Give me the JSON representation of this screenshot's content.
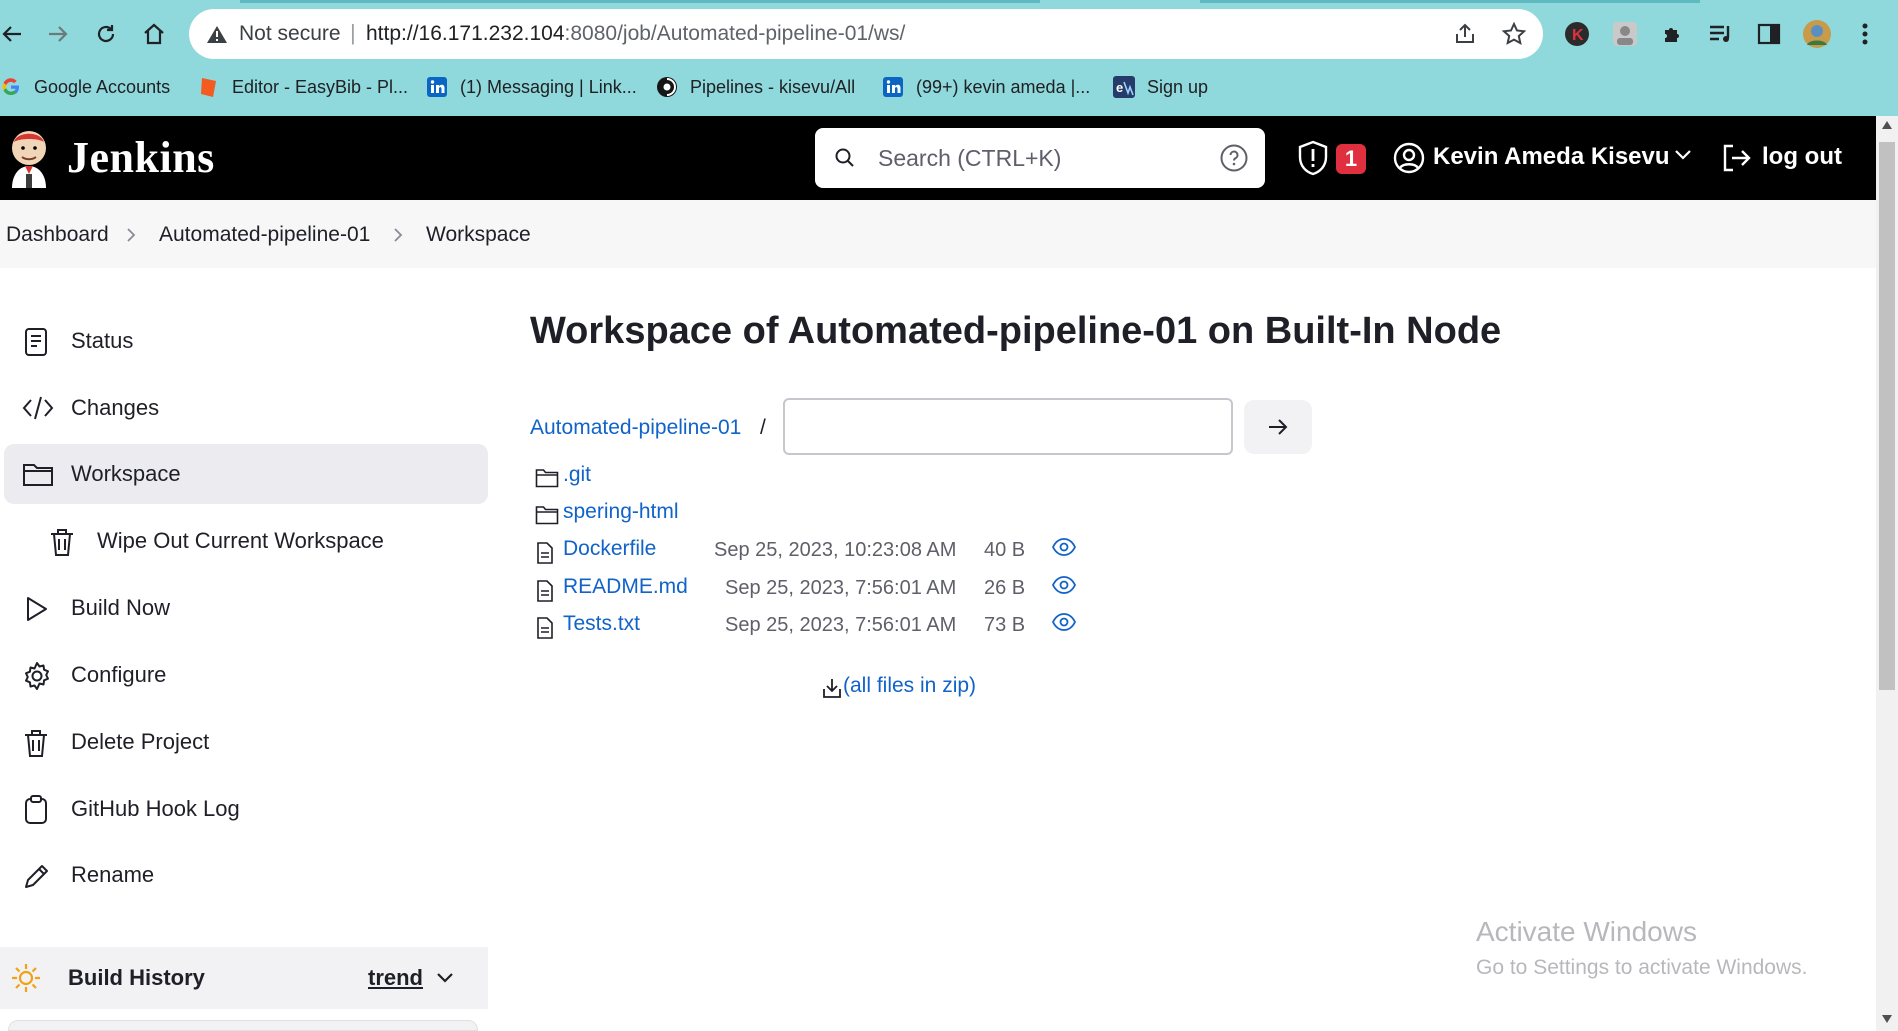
{
  "browser": {
    "security_label": "Not secure",
    "url_host": "http://16.171.232.104",
    "url_rest": ":8080/job/Automated-pipeline-01/ws/",
    "bookmarks": [
      {
        "label": "Google Accounts",
        "icon": "google-icon"
      },
      {
        "label": "Editor - EasyBib - Pl...",
        "icon": "easybib-icon"
      },
      {
        "label": "(1) Messaging | Link...",
        "icon": "linkedin-icon"
      },
      {
        "label": "Pipelines - kisevu/All",
        "icon": "circleci-icon"
      },
      {
        "label": "(99+) kevin ameda |...",
        "icon": "linkedin-icon"
      },
      {
        "label": "Sign up",
        "icon": "signup-icon"
      }
    ]
  },
  "header": {
    "brand": "Jenkins",
    "search_placeholder": "Search (CTRL+K)",
    "security_count": "1",
    "user_name": "Kevin Ameda Kisevu",
    "logout_label": "log out"
  },
  "breadcrumb": [
    "Dashboard",
    "Automated-pipeline-01",
    "Workspace"
  ],
  "sidebar": {
    "items": [
      {
        "label": "Status",
        "icon": "status-icon"
      },
      {
        "label": "Changes",
        "icon": "code-icon"
      },
      {
        "label": "Workspace",
        "icon": "folder-icon",
        "active": true
      },
      {
        "label": "Wipe Out Current Workspace",
        "icon": "trash-icon"
      },
      {
        "label": "Build Now",
        "icon": "play-icon"
      },
      {
        "label": "Configure",
        "icon": "gear-icon"
      },
      {
        "label": "Delete Project",
        "icon": "trash-icon"
      },
      {
        "label": "GitHub Hook Log",
        "icon": "clipboard-icon"
      },
      {
        "label": "Rename",
        "icon": "pencil-icon"
      }
    ],
    "build_history": {
      "title": "Build History",
      "trend": "trend"
    }
  },
  "main": {
    "title": "Workspace of Automated-pipeline-01 on Built-In Node",
    "root_link": "Automated-pipeline-01",
    "separator": "/",
    "path_input_value": "",
    "entries": [
      {
        "name": ".git",
        "type": "folder"
      },
      {
        "name": "spering-html",
        "type": "folder"
      },
      {
        "name": "Dockerfile",
        "type": "file",
        "date": "Sep 25, 2023, 10:23:08 AM",
        "size": "40 B"
      },
      {
        "name": "README.md",
        "type": "file",
        "date": "Sep 25, 2023, 7:56:01 AM",
        "size": "26 B"
      },
      {
        "name": "Tests.txt",
        "type": "file",
        "date": "Sep 25, 2023, 7:56:01 AM",
        "size": "73 B"
      }
    ],
    "zip_link": "(all files in zip)"
  },
  "watermark": {
    "title": "Activate Windows",
    "subtitle": "Go to Settings to activate Windows."
  },
  "colors": {
    "chrome_bg": "#8fd8dc",
    "jenkins_header": "#000000",
    "link_blue": "#1163c9",
    "badge_red": "#e0303f"
  }
}
